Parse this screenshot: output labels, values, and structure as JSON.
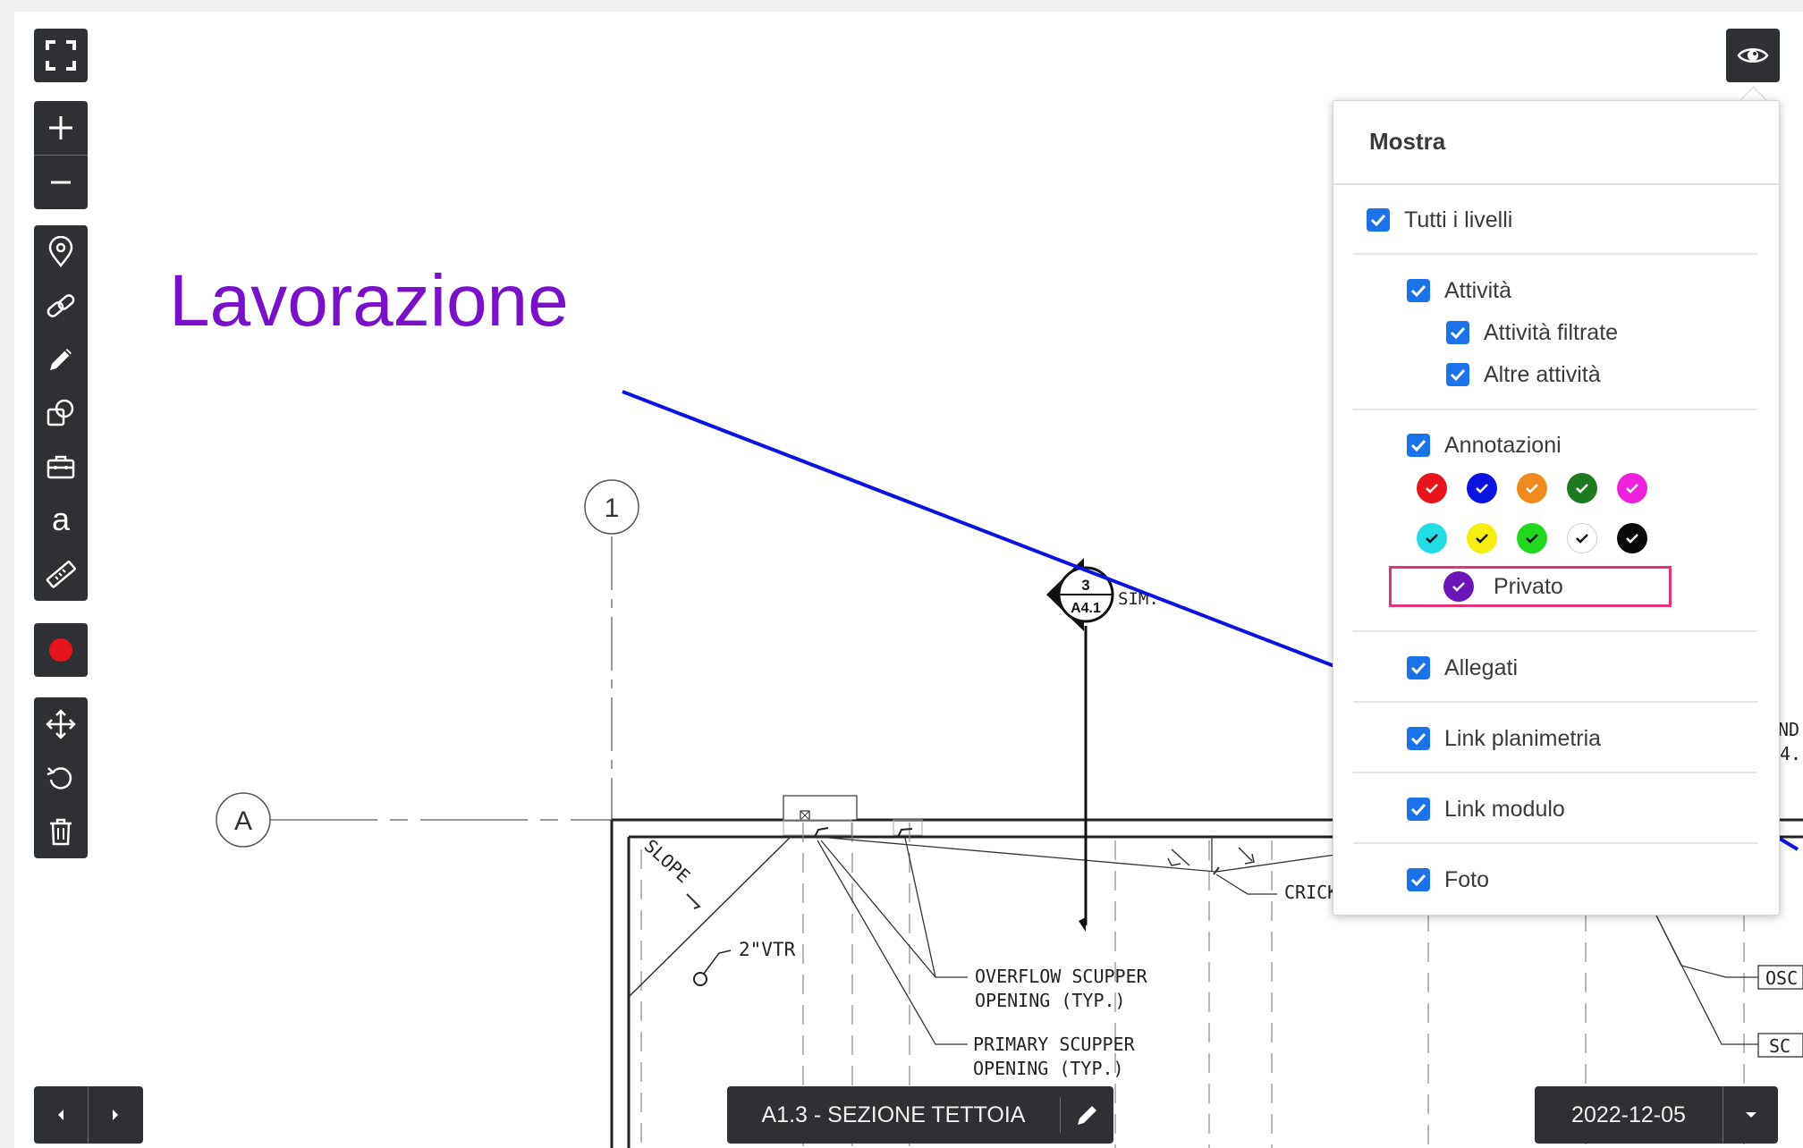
{
  "annotation_text": "Lavorazione",
  "drawing": {
    "grid_markers": [
      "1",
      "A"
    ],
    "section_tag_top": "3",
    "section_tag_bottom": "A4.1",
    "sim_label": "SIM.",
    "notes": {
      "slope": "SLOPE",
      "vtr": "2\"VTR",
      "overflow_1": "OVERFLOW SCUPPER",
      "overflow_2": "OPENING (TYP.)",
      "primary_1": "PRIMARY SCUPPER",
      "primary_2": "OPENING (TYP.)",
      "cricket": "CRICK",
      "right_nd": "ND",
      "right_4": "4.",
      "right_osc": "OSC",
      "right_sc": "SC"
    }
  },
  "toolbar": {
    "fullscreen": "fullscreen-icon",
    "zoom_in": "plus-icon",
    "zoom_out": "minus-icon",
    "tools": [
      "pin-icon",
      "link-icon",
      "pencil-icon",
      "shapes-icon",
      "toolbox-icon",
      "text-icon",
      "ruler-icon"
    ],
    "record_color": "#e8141c",
    "edit_tools": [
      "move-icon",
      "rotate-icon",
      "trash-icon"
    ]
  },
  "panel": {
    "title": "Mostra",
    "all_levels": "Tutti i livelli",
    "activities": "Attività",
    "filtered_activities": "Attività filtrate",
    "other_activities": "Altre attività",
    "annotations": "Annotazioni",
    "colors_row1": [
      "#e8141c",
      "#0a14e0",
      "#f08a1c",
      "#1e7a1e",
      "#ee22dd"
    ],
    "colors_row2": [
      "#22dde6",
      "#f5ee10",
      "#22d81e",
      "#ffffff",
      "#0a0a0a"
    ],
    "private": "Privato",
    "private_color": "#6a16b8",
    "attachments": "Allegati",
    "plan_link": "Link planimetria",
    "form_link": "Link modulo",
    "photos": "Foto"
  },
  "bottom": {
    "sheet_title": "A1.3 - SEZIONE TETTOIA",
    "date": "2022-12-05"
  },
  "colors": {
    "accent_checkbox": "#1a73e8",
    "markup_line": "#0a14e0",
    "text_annotation": "#7a10c8",
    "highlight": "#e5337a"
  }
}
